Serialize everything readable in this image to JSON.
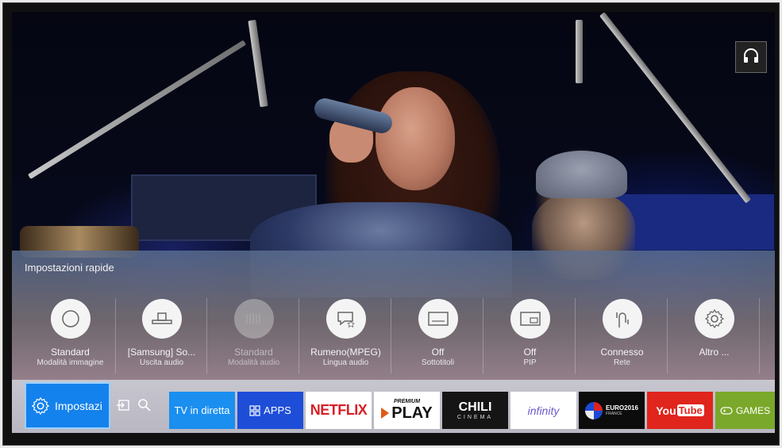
{
  "audio_output_icon": "headphone-icon",
  "quick_settings": {
    "title": "Impostazioni rapide",
    "items": [
      {
        "value": "Standard",
        "label": "Modalità immagine",
        "icon": "circle-icon"
      },
      {
        "value": "[Samsung] So...",
        "label": "Uscita audio",
        "icon": "soundbar-icon"
      },
      {
        "value": "Standard",
        "label": "Modalità audio",
        "icon": "audio-mode-icon",
        "disabled": true
      },
      {
        "value": "Rumeno(MPEG)",
        "label": "Lingua audio",
        "icon": "speech-bubble-icon"
      },
      {
        "value": "Off",
        "label": "Sottotitoli",
        "icon": "subtitles-icon"
      },
      {
        "value": "Off",
        "label": "PIP",
        "icon": "pip-icon"
      },
      {
        "value": "Connesso",
        "label": "Rete",
        "icon": "network-icon"
      },
      {
        "value": "Altro ...",
        "label": "",
        "icon": "gear-icon"
      }
    ]
  },
  "bottom_bar": {
    "settings_label": "Impostazi",
    "apps": [
      {
        "label": "TV in diretta"
      },
      {
        "label": "APPS"
      },
      {
        "label": "NETFLIX"
      },
      {
        "label": "PREMIUM",
        "label2": "PLAY"
      },
      {
        "label": "CHILI",
        "label2": "CINEMA"
      },
      {
        "label": "infinity"
      },
      {
        "label": "EURO2016",
        "label2": "FRANCE"
      },
      {
        "label": "You",
        "label2": "Tube"
      },
      {
        "label": "GAMES"
      }
    ]
  },
  "colors": {
    "accent": "#1482ec",
    "tv_tile": "#1a8ff0",
    "apps_tile": "#1e4ed8",
    "netflix_red": "#d81f26",
    "youtube_red": "#e0251c",
    "games_green": "#7aa82a"
  }
}
